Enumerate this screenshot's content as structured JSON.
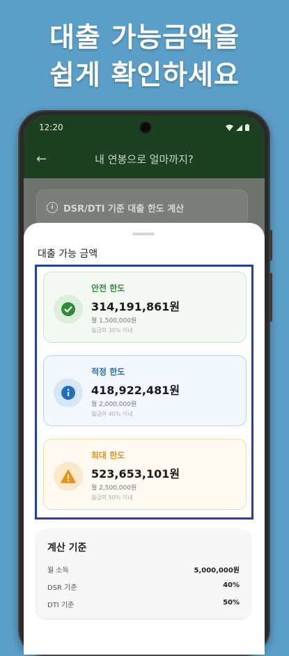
{
  "promo": {
    "headline_line1": "대출 가능금액을",
    "headline_line2": "쉽게 확인하세요"
  },
  "status_bar": {
    "time": "12:20"
  },
  "app_bar": {
    "back_icon": "back-arrow-icon",
    "title": "내 연봉으로 얼마까지?"
  },
  "info_card": {
    "text": "DSR/DTI 기준 대출 한도 계산"
  },
  "sheet": {
    "title": "대출 가능 금액",
    "limits": [
      {
        "label": "안전 한도",
        "amount": "314,191,861원",
        "monthly": "월 1,500,000원",
        "ratio": "월급의 30% 이내",
        "icon": "check-circle-icon",
        "color": "#2e8b3a"
      },
      {
        "label": "적정 한도",
        "amount": "418,922,481원",
        "monthly": "월 2,000,000원",
        "ratio": "월급의 40% 이내",
        "icon": "info-circle-icon",
        "color": "#1f6fbf"
      },
      {
        "label": "최대 한도",
        "amount": "523,653,101원",
        "monthly": "월 2,500,000원",
        "ratio": "월급의 50% 이내",
        "icon": "warning-triangle-icon",
        "color": "#e69216"
      }
    ]
  },
  "basis": {
    "title": "계산 기준",
    "rows": [
      {
        "label": "월 소득",
        "value": "5,000,000원"
      },
      {
        "label": "DSR 기준",
        "value": "40%"
      },
      {
        "label": "DTI 기준",
        "value": "50%"
      }
    ]
  }
}
